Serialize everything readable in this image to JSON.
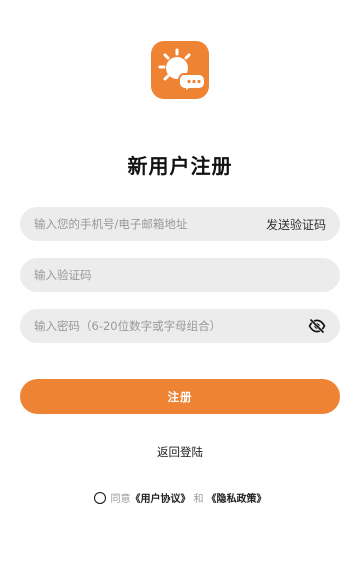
{
  "logo": {
    "icon": "sun-chat-logo-icon",
    "color": "#ee8433"
  },
  "title": "新用户注册",
  "phone_field": {
    "placeholder": "输入您的手机号/电子邮箱地址",
    "value": ""
  },
  "send_code_label": "发送验证码",
  "code_field": {
    "placeholder": "输入验证码",
    "value": ""
  },
  "password_field": {
    "placeholder": "输入密码（6-20位数字或字母组合）",
    "value": "",
    "toggle_icon": "eye-off-icon"
  },
  "submit_label": "注册",
  "back_login_label": "返回登陆",
  "agreement": {
    "agree_text": "同意",
    "user_agreement": "《用户协议》",
    "and_text": "和",
    "privacy_policy": "《隐私政策》"
  },
  "colors": {
    "accent": "#ee8433",
    "field_bg": "#ececec"
  }
}
